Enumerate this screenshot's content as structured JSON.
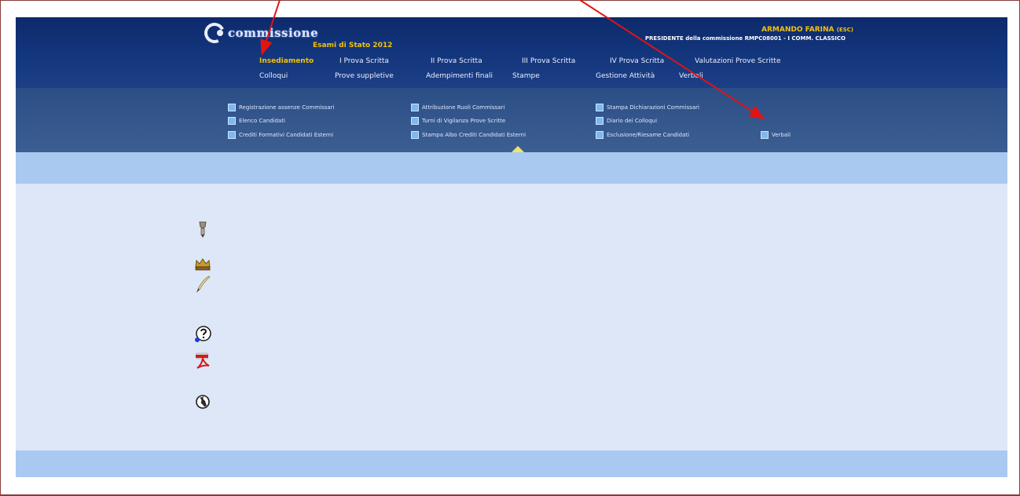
{
  "header": {
    "logo_text": "commissione",
    "subtitle": "Esami di Stato 2012",
    "user_name": "ARMANDO FARINA",
    "user_name_suffix": "(ESC)",
    "user_role": "PRESIDENTE della commissione RMPC08001 - I COMM. CLASSICO"
  },
  "menu": {
    "row1": [
      "Insediamento",
      "I Prova Scritta",
      "II Prova Scritta",
      "III Prova Scritta",
      "IV Prova Scritta",
      "Valutazioni Prove Scritte"
    ],
    "row2": [
      "Colloqui",
      "Prove suppletive",
      "Adempimenti finali",
      "Stampe",
      "Gestione Attività",
      "Verbali"
    ],
    "active": "Insediamento"
  },
  "submenu": {
    "col1": [
      "Registrazione assenze Commissari",
      "Elenco Candidati",
      "Crediti Formativi Candidati Esterni"
    ],
    "col2": [
      "Attribuzione Ruoli Commissari",
      "Turni di Vigilanza Prove Scritte",
      "Stampa Albo Crediti Candidati Esterni"
    ],
    "col3": [
      "Stampa Dichiarazioni Commissari",
      "Diario dei Colloqui",
      "Esclusione/Riesame Candidati"
    ],
    "col4": [
      "Verbali"
    ]
  },
  "side_icons": [
    "pen-nib-icon",
    "crown-icon",
    "quill-icon",
    "help-icon",
    "pdf-icon",
    "globe-icon"
  ],
  "colors": {
    "header_bg": "#12347a",
    "accent": "#f2c20b",
    "light_band": "#a9c9f0",
    "content_bg": "#dde7f7",
    "annotation_arrow": "#e21313"
  }
}
